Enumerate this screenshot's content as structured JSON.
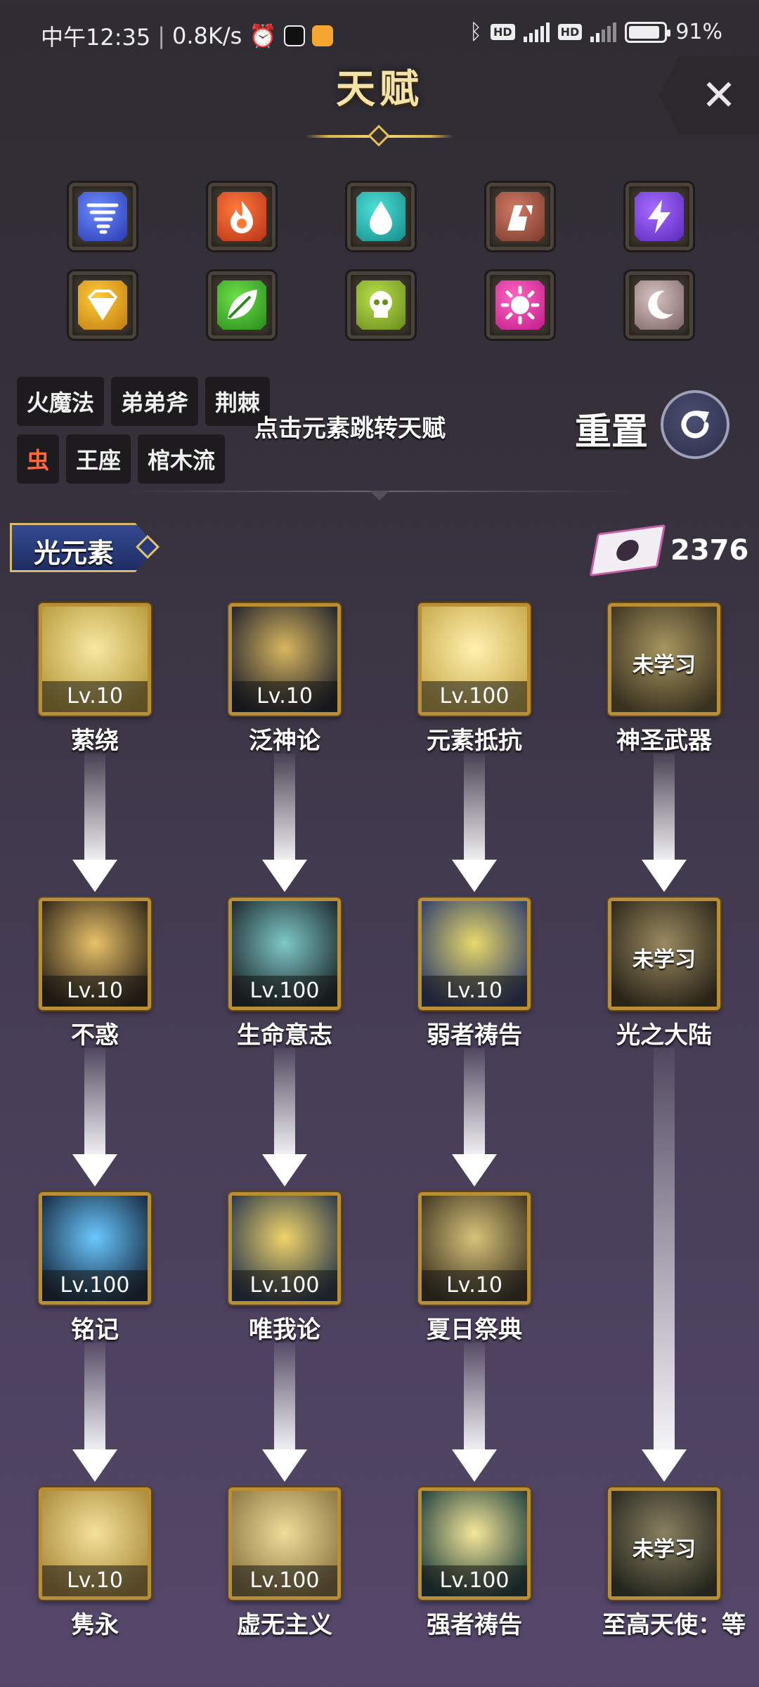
{
  "status": {
    "time": "中午12:35",
    "speed": "0.8K/s",
    "battery": "91%"
  },
  "title": "天赋",
  "close_glyph": "✕",
  "elements": [
    {
      "name": "wind-element-icon",
      "colors": [
        "#6d8bff",
        "#2a3bb0"
      ],
      "glyph": "tornado"
    },
    {
      "name": "fire-element-icon",
      "colors": [
        "#ff7a3a",
        "#b8321a"
      ],
      "glyph": "flame"
    },
    {
      "name": "water-element-icon",
      "colors": [
        "#4fe0d6",
        "#158c8c"
      ],
      "glyph": "drop"
    },
    {
      "name": "earth-element-icon",
      "colors": [
        "#d07a64",
        "#7a3a2c"
      ],
      "glyph": "rock"
    },
    {
      "name": "thunder-element-icon",
      "colors": [
        "#a66cff",
        "#5a2abb"
      ],
      "glyph": "bolt"
    },
    {
      "name": "gold-element-icon",
      "colors": [
        "#ffcc3a",
        "#c07c10"
      ],
      "glyph": "diamond"
    },
    {
      "name": "wood-element-icon",
      "colors": [
        "#6de04a",
        "#2a8a1c"
      ],
      "glyph": "leaf"
    },
    {
      "name": "poison-element-icon",
      "colors": [
        "#b9e04a",
        "#6a8a1c"
      ],
      "glyph": "skull"
    },
    {
      "name": "light-element-icon",
      "colors": [
        "#ff66c4",
        "#c01a8a"
      ],
      "glyph": "sun"
    },
    {
      "name": "dark-element-icon",
      "colors": [
        "#d8c2c2",
        "#7a6464"
      ],
      "glyph": "moon"
    }
  ],
  "tags": [
    [
      {
        "label": "火魔法",
        "active": false
      },
      {
        "label": "弟弟斧",
        "active": false
      },
      {
        "label": "荆棘",
        "active": false
      }
    ],
    [
      {
        "label": "虫",
        "active": true
      },
      {
        "label": "王座",
        "active": false
      },
      {
        "label": "棺木流",
        "active": false
      }
    ]
  ],
  "hint": "点击元素跳转天赋",
  "reset_label": "重置",
  "section": "光元素",
  "points": "2376",
  "locked_text": "未学习",
  "talents": [
    [
      {
        "name": "萦绕",
        "level": "Lv.10",
        "learned": true,
        "art": [
          "#f6e9a3",
          "#b89a3a"
        ]
      },
      {
        "name": "泛神论",
        "level": "Lv.10",
        "learned": true,
        "art": [
          "#d8b760",
          "#1c1e2a"
        ]
      },
      {
        "name": "元素抵抗",
        "level": "Lv.100",
        "learned": true,
        "art": [
          "#fff2b0",
          "#c8a84a"
        ]
      },
      {
        "name": "神圣武器",
        "level": "",
        "learned": false,
        "art": [
          "#a89660",
          "#3a3220"
        ]
      }
    ],
    [
      {
        "name": "不惑",
        "level": "Lv.10",
        "learned": true,
        "art": [
          "#e8c26a",
          "#2a2014"
        ]
      },
      {
        "name": "生命意志",
        "level": "Lv.100",
        "learned": true,
        "art": [
          "#7fc8c8",
          "#1a2428"
        ]
      },
      {
        "name": "弱者祷告",
        "level": "Lv.10",
        "learned": true,
        "art": [
          "#e8d96a",
          "#2a3a6a"
        ]
      },
      {
        "name": "光之大陆",
        "level": "",
        "learned": false,
        "art": [
          "#9a8a60",
          "#2a2418"
        ]
      }
    ],
    [
      {
        "name": "铭记",
        "level": "Lv.100",
        "learned": true,
        "art": [
          "#6ac8ff",
          "#14243a"
        ]
      },
      {
        "name": "唯我论",
        "level": "Lv.100",
        "learned": true,
        "art": [
          "#f0d46a",
          "#24344a"
        ]
      },
      {
        "name": "夏日祭典",
        "level": "Lv.10",
        "learned": true,
        "art": [
          "#d8c27a",
          "#3a3220"
        ]
      }
    ],
    [
      {
        "name": "隽永",
        "level": "Lv.10",
        "learned": true,
        "art": [
          "#f4e29a",
          "#a8883a"
        ]
      },
      {
        "name": "虚无主义",
        "level": "Lv.100",
        "learned": true,
        "art": [
          "#f0dc9a",
          "#8a7440"
        ]
      },
      {
        "name": "强者祷告",
        "level": "Lv.100",
        "learned": true,
        "art": [
          "#f6e89a",
          "#1a3a3a"
        ]
      },
      {
        "name": "至高天使：等",
        "level": "",
        "learned": false,
        "art": [
          "#8a8060",
          "#24261e"
        ]
      }
    ]
  ]
}
